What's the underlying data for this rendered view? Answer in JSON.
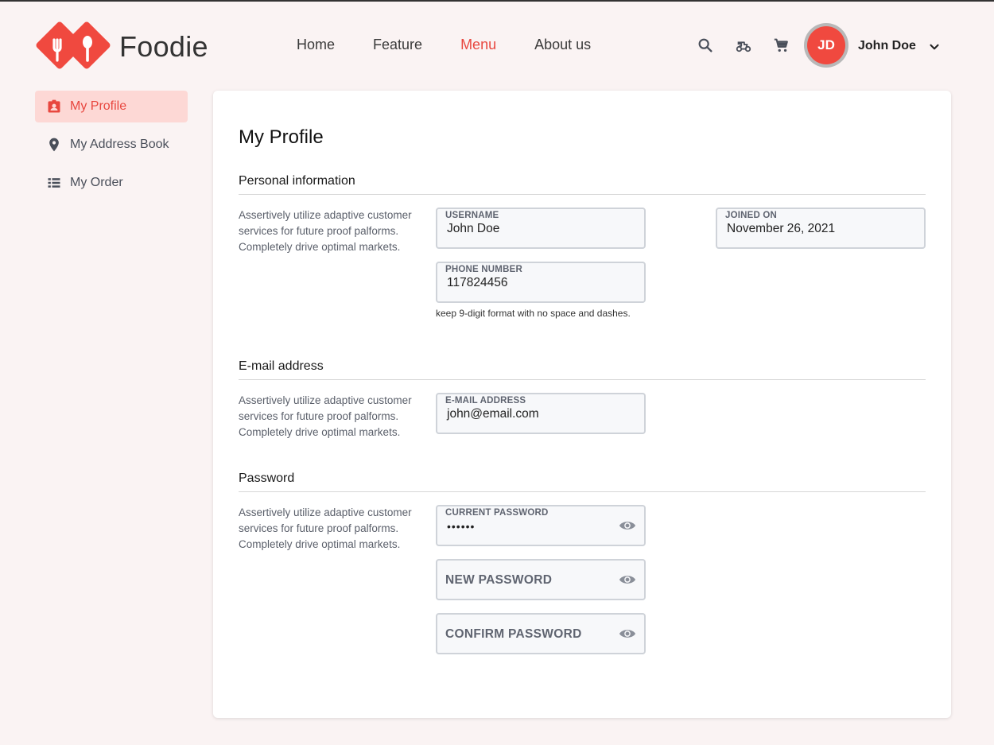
{
  "brand": {
    "name": "Foodie",
    "accent": "#e8473f"
  },
  "nav": {
    "items": [
      "Home",
      "Feature",
      "Menu",
      "About us"
    ],
    "active": "Menu"
  },
  "header": {
    "icons": [
      "search-icon",
      "delivery-scooter-icon",
      "cart-icon"
    ],
    "user": {
      "initials": "JD",
      "name": "John Doe"
    }
  },
  "sidebar": {
    "items": [
      {
        "label": "My Profile",
        "icon": "profile-badge-icon",
        "active": true
      },
      {
        "label": "My Address Book",
        "icon": "location-pin-icon",
        "active": false
      },
      {
        "label": "My Order",
        "icon": "list-icon",
        "active": false
      }
    ]
  },
  "profile": {
    "title": "My Profile",
    "sections": {
      "personal": {
        "title": "Personal information",
        "desc": "Assertively utilize adaptive customer services for future proof palforms. Completely drive optimal markets.",
        "username_label": "USERNAME",
        "username_value": "John Doe",
        "joined_label": "JOINED ON",
        "joined_value": "November 26, 2021",
        "phone_label": "PHONE NUMBER",
        "phone_value": "117824456",
        "phone_hint": "keep 9-digit format with no space and dashes."
      },
      "email": {
        "title": "E-mail address",
        "desc": "Assertively utilize adaptive customer services for future proof palforms. Completely drive optimal markets.",
        "email_label": "E-MAIL ADDRESS",
        "email_value": "john@email.com"
      },
      "password": {
        "title": "Password",
        "desc": "Assertively utilize adaptive customer services for future proof palforms. Completely drive optimal markets.",
        "current_label": "CURRENT PASSWORD",
        "current_value": "••••••",
        "new_placeholder": "NEW PASSWORD",
        "confirm_placeholder": "CONFIRM PASSWORD"
      }
    }
  }
}
